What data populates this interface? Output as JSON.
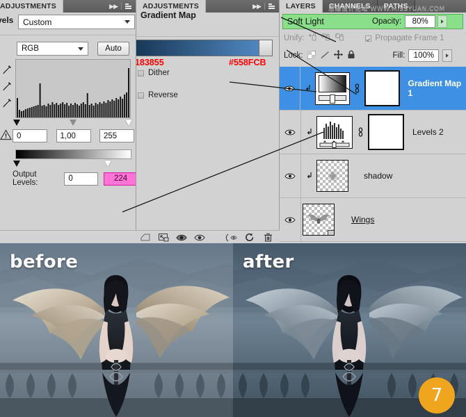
{
  "adjustments_panel": {
    "tab_label": "ADJUSTMENTS",
    "collapse_icon": "double-arrow-right-icon",
    "menu_icon": "panel-menu-icon"
  },
  "levels": {
    "title": "Levels",
    "preset": "Custom",
    "channel": "RGB",
    "auto_button": "Auto",
    "input_black": "0",
    "input_gamma": "1,00",
    "input_white": "255",
    "output_label": "Output Levels:",
    "output_black": "0",
    "output_white": "224",
    "output_white_highlight": "#ff73d7",
    "eyedroppers": [
      "black-point-eyedropper",
      "gray-point-eyedropper",
      "white-point-eyedropper"
    ],
    "clipping_warning_icon": "clipping-warning-icon"
  },
  "gradient_map": {
    "tab_label": "ADJUSTMENTS",
    "title": "Gradient Map",
    "gradient_start_hex": "#183855",
    "gradient_end_hex": "#558FCB",
    "hex_label_left": "#183855",
    "hex_label_right": "#558FCB",
    "hex_label_color": "#ff0000",
    "dither_label": "Dither",
    "dither_checked": false,
    "reverse_label": "Reverse",
    "reverse_checked": false,
    "bottom_icons": [
      "return-to-adjustment-list-icon",
      "clip-to-layer-icon",
      "toggle-layer-visibility-icon",
      "preview-eye-icon",
      "view-previous-state-icon",
      "reset-adjustment-icon",
      "delete-adjustment-layer-icon"
    ]
  },
  "layers_panel": {
    "tabs": [
      {
        "label": "LAYERS",
        "active": true
      },
      {
        "label": "CHANNELS",
        "active": false
      },
      {
        "label": "PATHS",
        "active": false
      }
    ],
    "watermark": "思缘设计论坛  WWW.MISSYUAN.COM",
    "blend_mode": "Soft Light",
    "blend_highlight_color": "#8ae08a",
    "opacity_label": "Opacity:",
    "opacity_value": "80%",
    "unify_label": "Unify:",
    "unify_icons": [
      "unify-position-icon",
      "unify-visibility-icon",
      "unify-style-icon"
    ],
    "propagate_label": "Propagate Frame 1",
    "propagate_checked": true,
    "lock_label": "Lock:",
    "lock_icons": [
      "lock-transparent-pixels-icon",
      "lock-image-pixels-icon",
      "lock-position-icon",
      "lock-all-icon"
    ],
    "fill_label": "Fill:",
    "fill_value": "100%",
    "layers": [
      {
        "name": "Gradient Map 1",
        "selected": true,
        "visible": true,
        "clipped": true,
        "thumb": "gradient-map-thumbnail",
        "linked": true,
        "mask": "white-layer-mask"
      },
      {
        "name": "Levels 2",
        "selected": false,
        "visible": true,
        "clipped": true,
        "thumb": "levels-histogram-thumbnail",
        "linked": true,
        "mask": "white-layer-mask"
      },
      {
        "name": "shadow",
        "selected": false,
        "visible": true,
        "clipped": true,
        "thumb": "transparent-shadow-thumbnail",
        "linked": false,
        "mask": null
      },
      {
        "name": "Wings",
        "selected": false,
        "visible": true,
        "clipped": false,
        "thumb": "transparent-wings-thumbnail",
        "linked": false,
        "mask": null,
        "underlined": true
      }
    ]
  },
  "comparison": {
    "before_caption": "before",
    "after_caption": "after",
    "step_badge": "7",
    "badge_color": "#f0a51e"
  }
}
